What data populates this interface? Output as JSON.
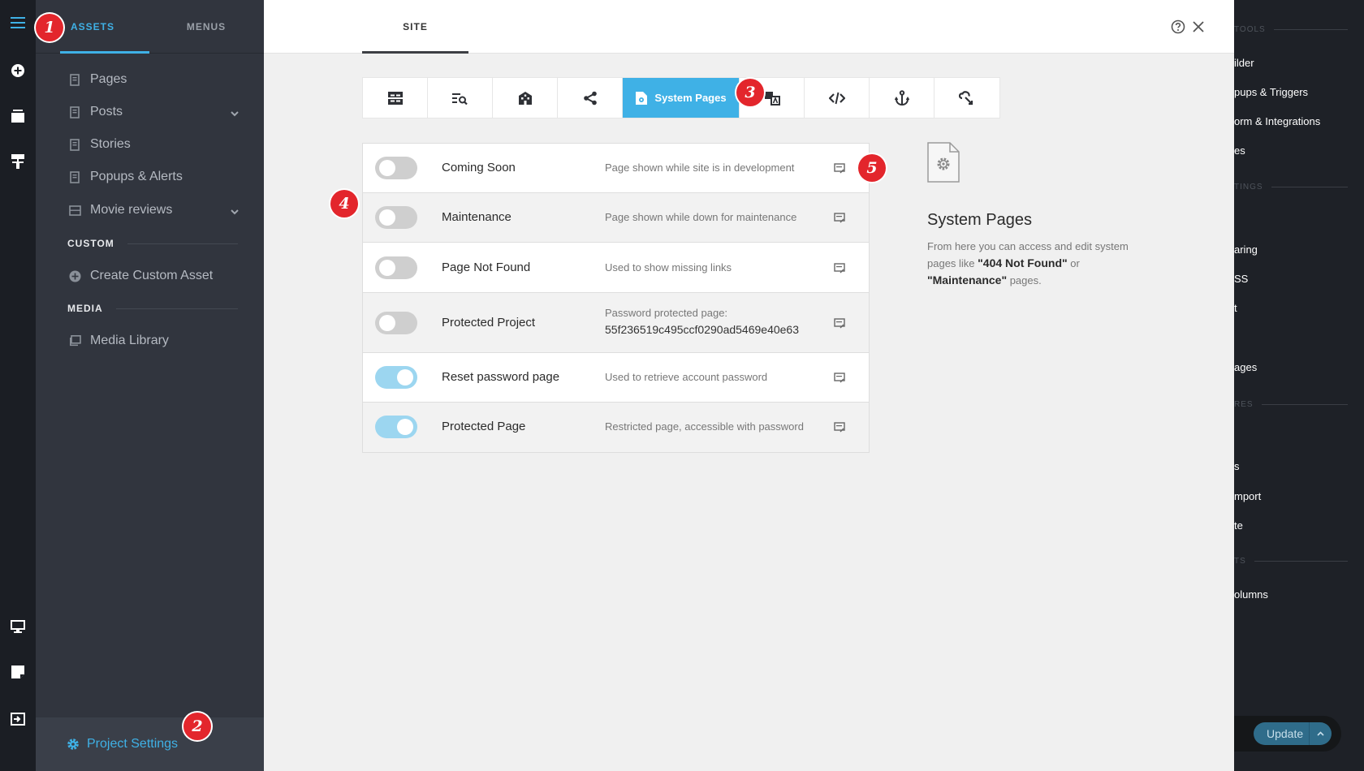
{
  "assets_panel": {
    "tabs": [
      {
        "label": "ASSETS",
        "active": true
      },
      {
        "label": "MENUS",
        "active": false
      }
    ],
    "items": [
      {
        "label": "Pages"
      },
      {
        "label": "Posts"
      },
      {
        "label": "Stories"
      },
      {
        "label": "Popups & Alerts"
      },
      {
        "label": "Movie reviews"
      }
    ],
    "custom_section": "CUSTOM",
    "create_custom": "Create Custom Asset",
    "media_section": "MEDIA",
    "media_library": "Media Library",
    "project_settings": "Project Settings"
  },
  "modal": {
    "site_tab": "SITE",
    "active_tab_label": "System Pages",
    "rows": [
      {
        "title": "Coming Soon",
        "desc": "Page shown while site is in development",
        "on": false
      },
      {
        "title": "Maintenance",
        "desc": "Page shown while down for maintenance",
        "on": false
      },
      {
        "title": "Page Not Found",
        "desc": "Used to show missing links",
        "on": false
      },
      {
        "title": "Protected Project",
        "desc": "Password protected page:",
        "hash": "55f236519c495ccf0290ad5469e40e63",
        "on": false
      },
      {
        "title": "Reset password page",
        "desc": "Used to retrieve account password",
        "on": true
      },
      {
        "title": "Protected Page",
        "desc": "Restricted page, accessible with password",
        "on": true
      }
    ],
    "info": {
      "title": "System Pages",
      "text_1": "From here you can access and edit system pages like ",
      "bold_1": "\"404 Not Found\"",
      "text_2": " or ",
      "bold_2": "\"Maintenance\"",
      "text_3": " pages."
    }
  },
  "right_sidebar": {
    "headers": [
      "TOOLS",
      "TINGS",
      "RES",
      "TS"
    ],
    "items": [
      "ilder",
      "pups & Triggers",
      "orm & Integrations",
      "es",
      "aring",
      "SS",
      "t",
      "ages",
      "s",
      "mport",
      "te",
      "olumns"
    ],
    "update_label": "Update"
  },
  "callouts": [
    "1",
    "2",
    "3",
    "4",
    "5"
  ],
  "colors": {
    "accent": "#3fb1e6",
    "callout": "#e3262c",
    "toggle_on": "#9cd6f0"
  }
}
